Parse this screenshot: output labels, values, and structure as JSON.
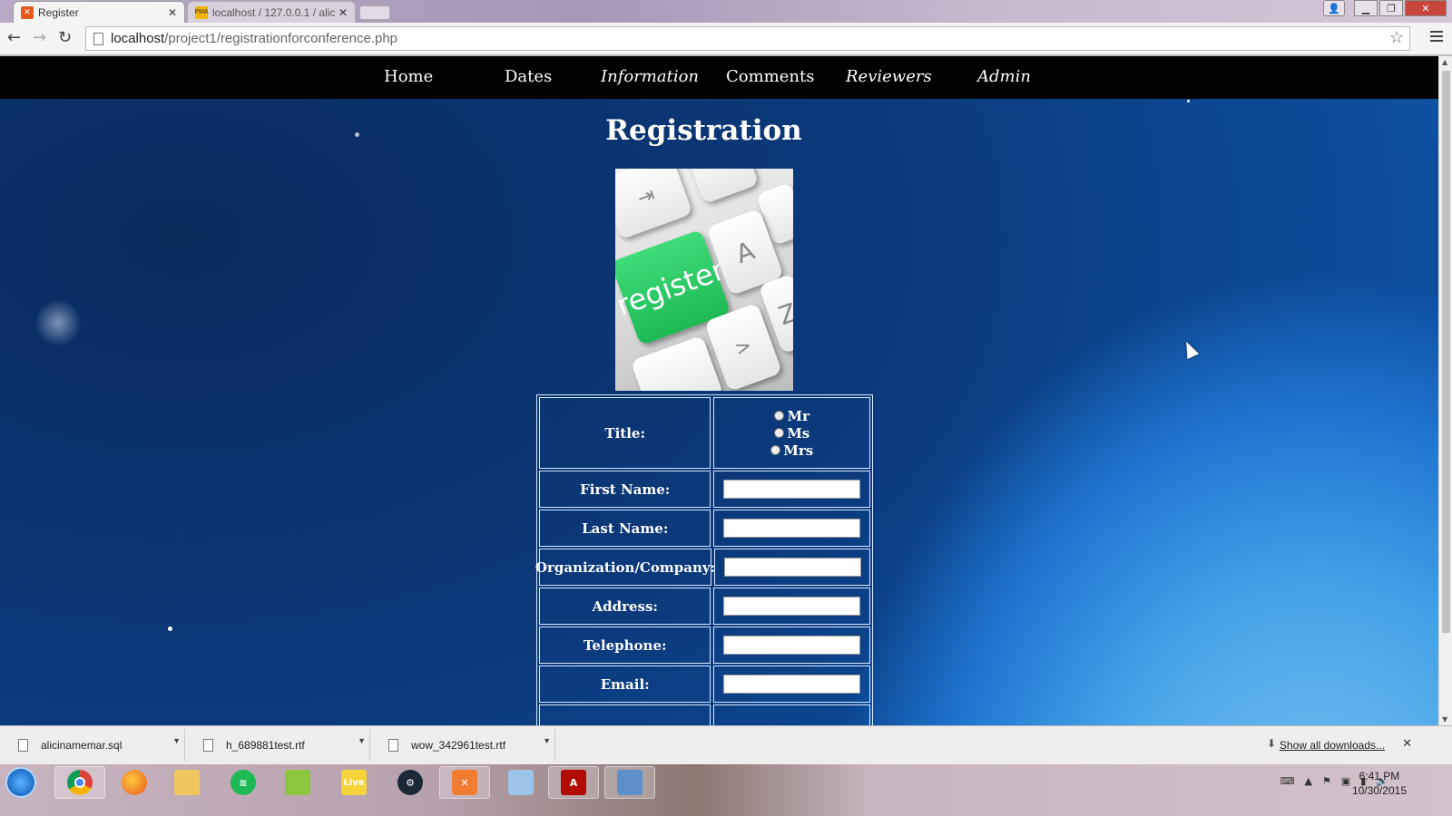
{
  "browser": {
    "tabs": [
      {
        "title": "Register",
        "favicon": "xampp-icon"
      },
      {
        "title": "localhost / 127.0.0.1 / alic",
        "favicon": "phpmyadmin-icon"
      }
    ],
    "url_host": "localhost",
    "url_path": "/project1/registrationforconference.php"
  },
  "nav": {
    "items": [
      {
        "label": "Home"
      },
      {
        "label": "Dates"
      },
      {
        "label": "Information"
      },
      {
        "label": "Comments"
      },
      {
        "label": "Reviewers"
      },
      {
        "label": "Admin"
      }
    ]
  },
  "page": {
    "title": "Registration",
    "image_text": "register",
    "key_letters": [
      "A",
      "Z"
    ],
    "form": {
      "title_label": "Title:",
      "title_options": [
        "Mr",
        "Ms",
        "Mrs"
      ],
      "fields": [
        {
          "label": "First Name:",
          "value": ""
        },
        {
          "label": "Last Name:",
          "value": ""
        },
        {
          "label": "Organization/Company:",
          "value": ""
        },
        {
          "label": "Address:",
          "value": ""
        },
        {
          "label": "Telephone:",
          "value": ""
        },
        {
          "label": "Email:",
          "value": ""
        }
      ]
    }
  },
  "downloads": {
    "items": [
      {
        "name": "alicinamemar.sql"
      },
      {
        "name": "h_689881test.rtf"
      },
      {
        "name": "wow_342961test.rtf"
      }
    ],
    "show_all": "Show all downloads..."
  },
  "taskbar": {
    "apps": [
      "chrome-icon",
      "firefox-icon",
      "file-explorer-icon",
      "spotify-icon",
      "notepad-icon",
      "live-icon",
      "steam-icon",
      "xampp-icon",
      "virtualbox-icon",
      "acrobat-icon",
      "control-panel-icon"
    ],
    "time": "6:41 PM",
    "date": "10/30/2015"
  },
  "colors": {
    "nav_bg": "#000000",
    "accent_green": "#1db954",
    "page_bg": "#0b3f85"
  }
}
